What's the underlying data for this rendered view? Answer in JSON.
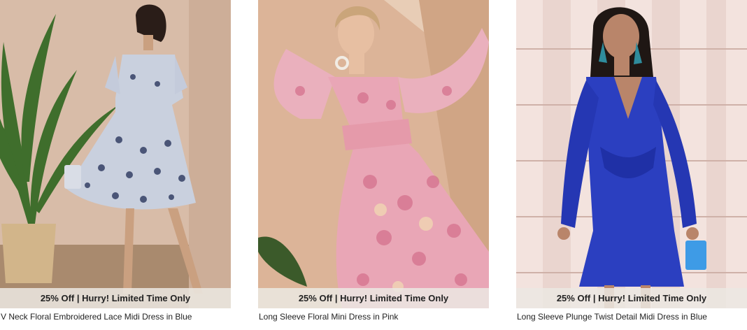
{
  "products": [
    {
      "promo": "25% Off | Hurry! Limited Time Only",
      "name": "V Neck Floral Embroidered Lace Midi Dress in Blue",
      "dress_color": "#c9d0de",
      "background_color": "#d6b9a3"
    },
    {
      "promo": "25% Off | Hurry! Limited Time Only",
      "name": "Long Sleeve Floral Mini Dress in Pink",
      "dress_color": "#e9a6b6",
      "background_color": "#dcb498"
    },
    {
      "promo": "25% Off | Hurry! Limited Time Only",
      "name": "Long Sleeve Plunge Twist Detail Midi Dress in Blue",
      "dress_color": "#2b3fc0",
      "background_color": "#e9d2cc"
    }
  ]
}
